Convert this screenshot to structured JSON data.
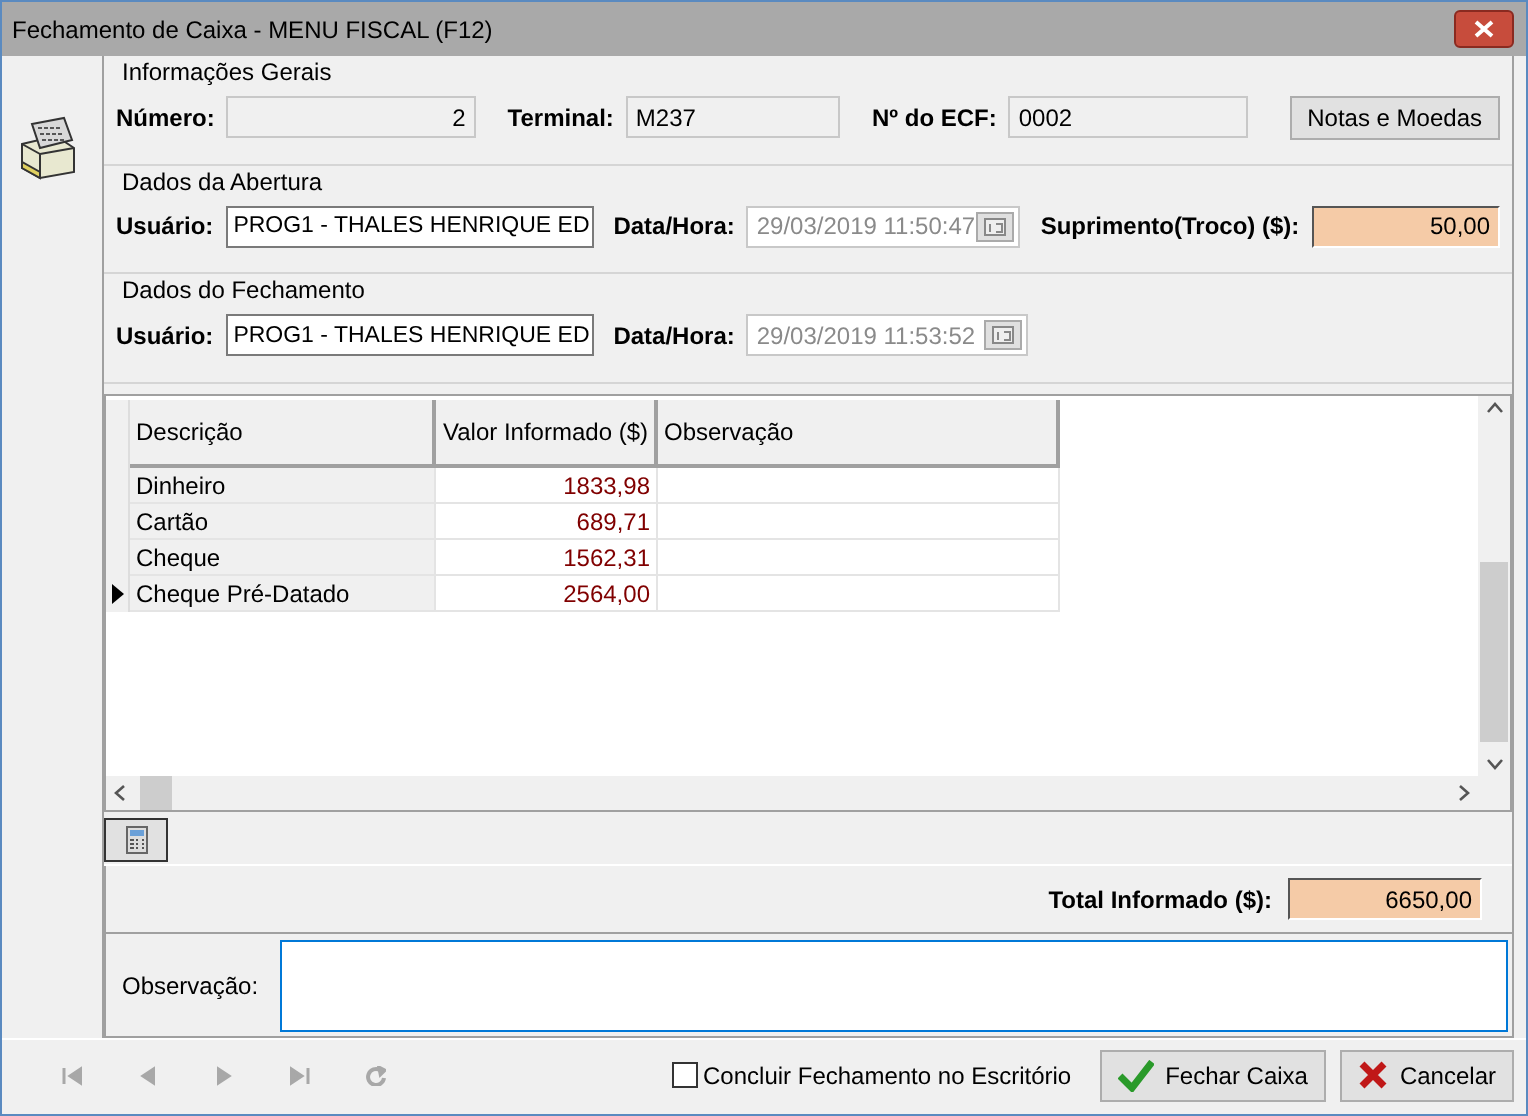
{
  "window": {
    "title": "Fechamento de Caixa - MENU FISCAL (F12)"
  },
  "general": {
    "title": "Informações Gerais",
    "fields": [
      {
        "label": "Número:",
        "value": "2",
        "kind": "number"
      },
      {
        "label": "Terminal:",
        "value": "M237",
        "kind": "text"
      },
      {
        "label": "Nº do ECF:",
        "value": "0002",
        "kind": "text"
      }
    ],
    "button": "Notas e Moedas"
  },
  "opening": {
    "title": "Dados da Abertura",
    "user_label": "Usuário:",
    "user": "PROG1 - THALES HENRIQUE ED",
    "date_label": "Data/Hora:",
    "date": "29/03/2019 11:50:47",
    "date_disabled": true,
    "supply_label": "Suprimento(Troco) ($):",
    "supply": "50,00"
  },
  "closing": {
    "title": "Dados do Fechamento",
    "user_label": "Usuário:",
    "user": "PROG1 - THALES HENRIQUE ED",
    "date_label": "Data/Hora:",
    "date": "29/03/2019 11:53:52",
    "date_disabled": true
  },
  "grid": {
    "columns": [
      "Descrição",
      "Valor Informado ($)",
      "Observação"
    ],
    "rows": [
      {
        "cells": [
          "Dinheiro",
          "1833,98"
        ],
        "selected": false
      },
      {
        "cells": [
          "Cartão",
          "689,71"
        ],
        "selected": false
      },
      {
        "cells": [
          "Cheque",
          "1562,31"
        ],
        "selected": false
      },
      {
        "cells": [
          "Cheque Pré-Datado",
          "2564,00"
        ],
        "selected": true
      }
    ]
  },
  "total": {
    "label": "Total Informado ($):",
    "value": "6650,00"
  },
  "observation": {
    "label": "Observação:"
  },
  "nav_buttons": [
    {
      "kind": "first",
      "disabled": true
    },
    {
      "kind": "prev",
      "disabled": true
    },
    {
      "kind": "next",
      "disabled": true
    },
    {
      "kind": "last",
      "disabled": true
    },
    {
      "kind": "refresh",
      "disabled": true
    }
  ],
  "office_checkbox": {
    "label": "Concluir Fechamento no Escritório",
    "checked": false
  },
  "buttons": [
    {
      "kind": "confirm",
      "label": "Fechar Caixa"
    },
    {
      "kind": "cancel",
      "label": "Cancelar"
    }
  ]
}
